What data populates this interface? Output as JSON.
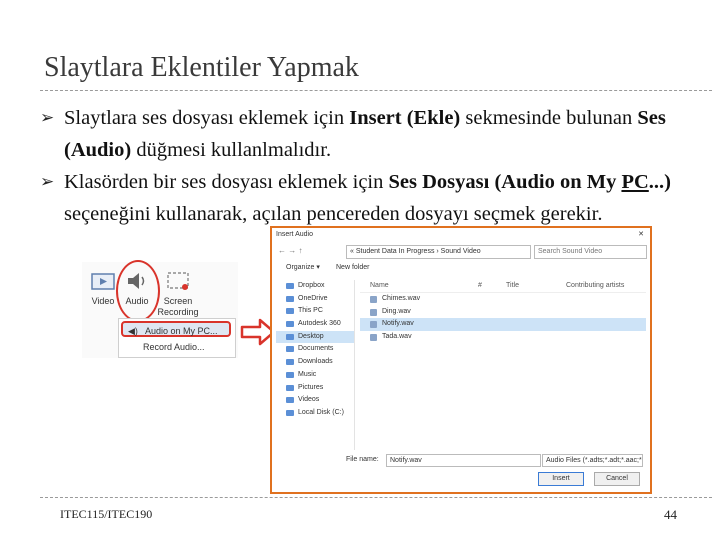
{
  "slide": {
    "title": "Slaytlara Eklentiler Yapmak",
    "bullet1": {
      "t1": "Slaytlara ses dosyası eklemek için ",
      "b1": "Insert (Ekle)",
      "t2": " sekmesinde bulunan ",
      "b2": "Ses (Audio)",
      "t3": " düğmesi kullanlmalıdır."
    },
    "bullet2": {
      "t1": "Klasörden bir ses dosyası eklemek için ",
      "b1": "Ses Dosyası (Audio on My ",
      "b1u": "PC",
      "b2": "...)",
      "t2": " seçeneğini kullanarak, açılan pencereden dosyayı seçmek gerekir."
    },
    "footer": "ITEC115/ITEC190",
    "page": "44"
  },
  "ribbon": {
    "video": "Video",
    "audio": "Audio",
    "screen": "Screen",
    "recording": "Recording",
    "menu_audio_pc": "Audio on My PC...",
    "menu_record": "Record Audio..."
  },
  "dialog": {
    "title": "Insert Audio",
    "close": "✕",
    "address": "« Student Data In Progress › Sound Video",
    "search_placeholder": "Search Sound Video",
    "organize": "Organize ▾",
    "new_folder": "New folder",
    "nav_items": [
      "Dropbox",
      "OneDrive",
      "This PC",
      "Autodesk 360",
      "Desktop",
      "Documents",
      "Downloads",
      "Music",
      "Pictures",
      "Videos",
      "Local Disk (C:)"
    ],
    "nav_selected_index": 4,
    "col_name": "Name",
    "col_num": "#",
    "col_title": "Title",
    "col_contrib": "Contributing artists",
    "files": [
      "Chimes.wav",
      "Ding.wav",
      "Notify.wav",
      "Tada.wav"
    ],
    "file_selected_index": 2,
    "filename_label": "File name:",
    "filename_value": "Notify.wav",
    "filetype_value": "Audio Files (*.adts;*.adt;*.aac;*",
    "insert_label": "Insert",
    "cancel_label": "Cancel"
  }
}
